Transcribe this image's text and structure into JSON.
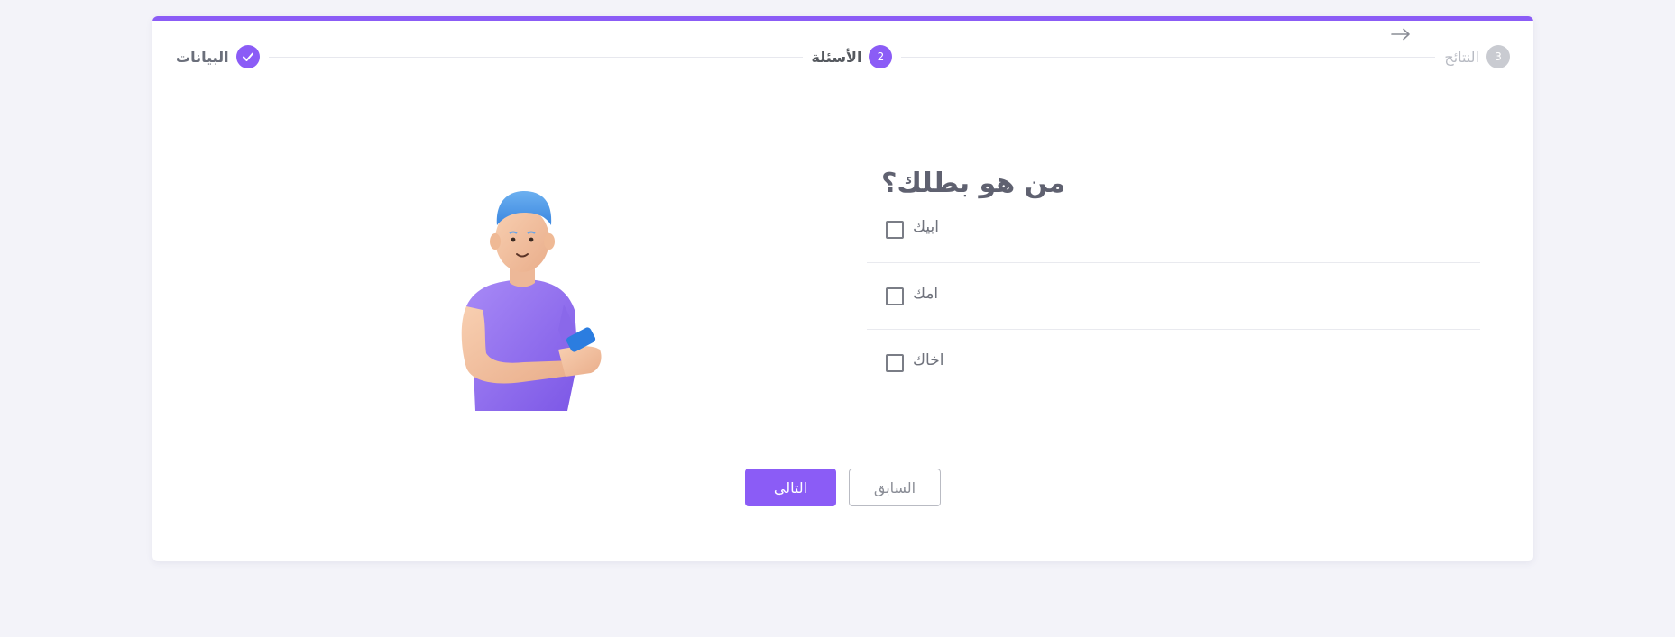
{
  "stepper": {
    "steps": [
      {
        "label": "البيانات",
        "state": "done",
        "icon": "check-icon"
      },
      {
        "label": "الأسئلة",
        "number": "2",
        "state": "active"
      },
      {
        "label": "النتائج",
        "number": "3",
        "state": "pending"
      }
    ],
    "back_icon": "arrow-right-icon"
  },
  "question": {
    "title": "من هو بطلك؟",
    "options": [
      {
        "label": "ابيك"
      },
      {
        "label": "امك"
      },
      {
        "label": "اخاك"
      }
    ]
  },
  "actions": {
    "next_label": "التالي",
    "prev_label": "السابق"
  },
  "colors": {
    "accent": "#8b5cf6",
    "background": "#f3f3f9",
    "pending_step": "#c9cbd1"
  }
}
